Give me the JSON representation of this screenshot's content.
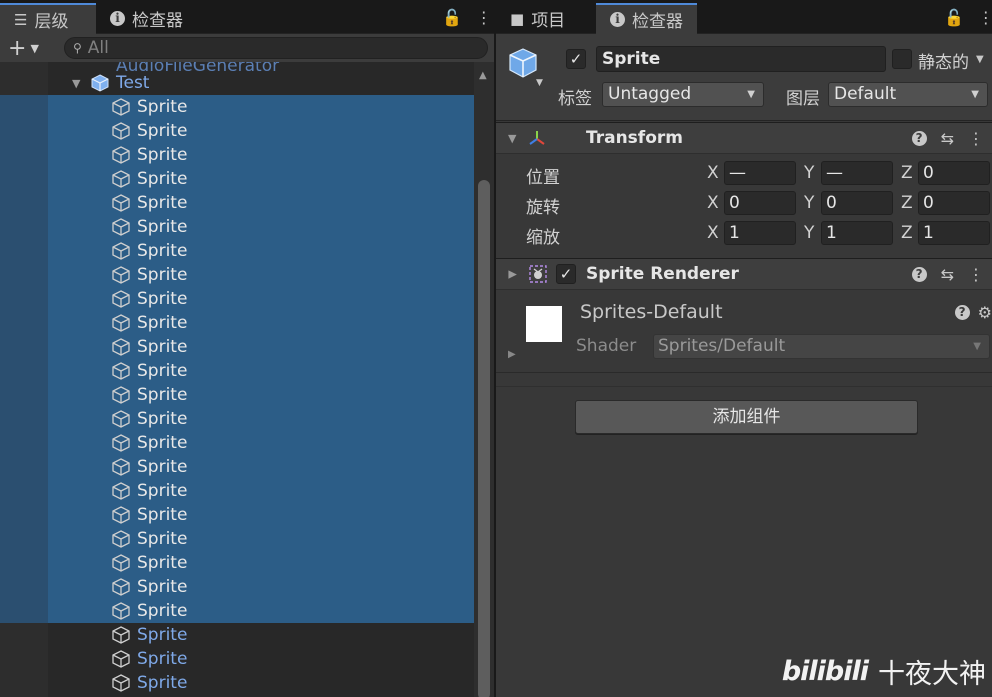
{
  "hierarchy": {
    "tab_label": "层级",
    "search_placeholder": "All",
    "clipped_item_label": "AudioFileGenerator",
    "parent_label": "Test",
    "selected_child_label": "Sprite",
    "selected_count": 22,
    "unselected_child_label": "Sprite",
    "unselected_count": 3
  },
  "inspector": {
    "tabs": {
      "project": "项目",
      "inspector": "检查器"
    },
    "gameobject": {
      "active": true,
      "name": "Sprite",
      "static_label": "静态的",
      "tag_label": "标签",
      "tag_value": "Untagged",
      "layer_label": "图层",
      "layer_value": "Default"
    },
    "transform": {
      "title": "Transform",
      "position_label": "位置",
      "rotation_label": "旋转",
      "scale_label": "缩放",
      "axis_x": "X",
      "axis_y": "Y",
      "axis_z": "Z",
      "position": {
        "x": "—",
        "y": "—",
        "z": "0"
      },
      "rotation": {
        "x": "0",
        "y": "0",
        "z": "0"
      },
      "scale": {
        "x": "1",
        "y": "1",
        "z": "1"
      }
    },
    "sprite_renderer": {
      "title": "Sprite Renderer",
      "enabled": true
    },
    "material": {
      "name": "Sprites-Default",
      "shader_label": "Shader",
      "shader_value": "Sprites/Default"
    },
    "add_component_label": "添加组件"
  },
  "icons": {
    "hierarchy_tab": "list-icon",
    "project_tab": "folder-icon",
    "inspector_tab": "info-icon",
    "lock": "lock-icon",
    "more": "kebab-menu-icon",
    "gameobject": "cube-icon",
    "transform": "transform-axes-icon",
    "sprite_renderer": "sprite-renderer-icon",
    "help": "help-icon",
    "preset": "preset-sliders-icon",
    "settings": "gear-icon"
  },
  "watermark": {
    "logo": "bilibili",
    "channel": "十夜大神"
  },
  "colors": {
    "selection": "#2c5d87",
    "accent": "#4f8ad9",
    "prefab_text": "#7fa9e8"
  }
}
